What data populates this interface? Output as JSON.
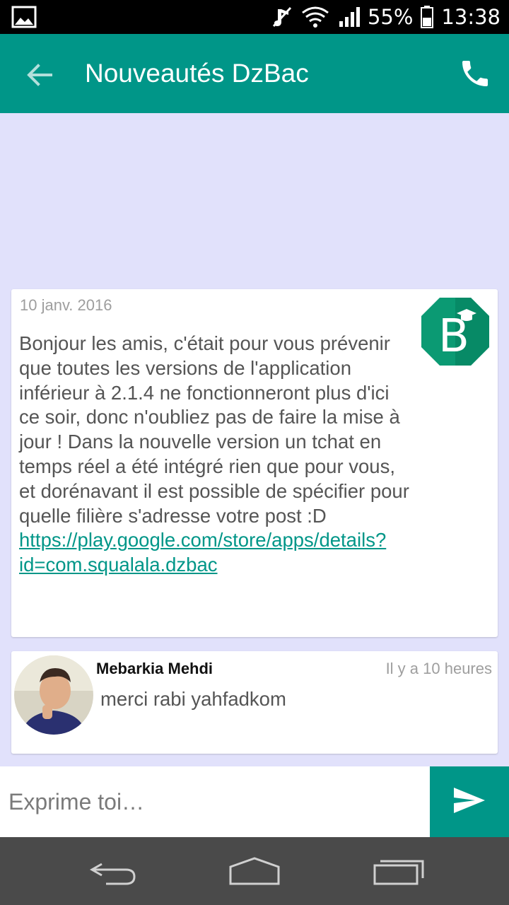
{
  "status_bar": {
    "battery": "55%",
    "time": "13:38",
    "icons": [
      "image-icon",
      "mute-icon",
      "wifi-icon",
      "signal-icon",
      "battery-icon"
    ]
  },
  "app_bar": {
    "title": "Nouveautés DzBac",
    "icons": [
      "back-arrow-icon",
      "phone-icon"
    ]
  },
  "post": {
    "date": "10 janv. 2016",
    "logo_letter": "B",
    "text": "Bonjour les amis, c'était pour vous prévenir que toutes les versions de l'application inférieur à 2.1.4 ne fonctionneront plus d'ici ce soir, donc n'oubliez pas de faire la mise à jour ! Dans la nouvelle version un tchat en temps réel a été intégré rien que pour vous, et dorénavant il est possible de spécifier pour quelle filière s'adresse votre post :D ",
    "link": "https://play.google.com/store/apps/details?id=com.squalala.dzbac"
  },
  "comment": {
    "author": "Mebarkia Mehdi",
    "time": "Il y a 10 heures",
    "text": "merci rabi yahfadkom"
  },
  "composer": {
    "placeholder": "Exprime toi…",
    "value": ""
  },
  "colors": {
    "primary": "#009688",
    "background": "#e1e1fb"
  }
}
